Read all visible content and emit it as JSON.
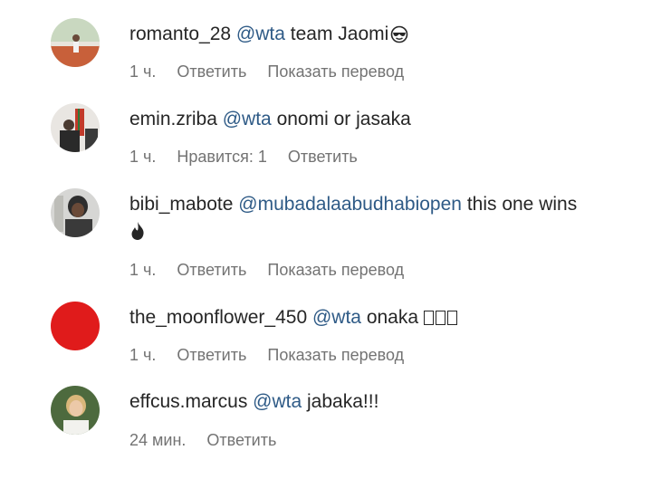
{
  "comments": [
    {
      "username": "romanto_28",
      "mention": "@wta",
      "text": "team Jaomi",
      "emoji": "smiling-face-with-sunglasses",
      "time": "1 ч.",
      "actions": [
        "Ответить",
        "Показать перевод"
      ]
    },
    {
      "username": "emin.zriba",
      "mention": "@wta",
      "text": "onomi or jasaka",
      "time": "1 ч.",
      "likes": "Нравится: 1",
      "actions": [
        "Ответить"
      ]
    },
    {
      "username": "bibi_mabote",
      "mention": "@mubadalaabudhabiopen",
      "text": "this one wins",
      "emoji": "fire",
      "time": "1 ч.",
      "actions": [
        "Ответить",
        "Показать перевод"
      ]
    },
    {
      "username": "the_moonflower_450",
      "mention": "@wta",
      "text": "onaka",
      "emoji": "unrendered-glyph-boxes",
      "time": "1 ч.",
      "actions": [
        "Ответить",
        "Показать перевод"
      ]
    },
    {
      "username": "effcus.marcus",
      "mention": "@wta",
      "text": "jabaka!!!",
      "time": "24 мин.",
      "actions": [
        "Ответить"
      ]
    }
  ],
  "colors": {
    "text": "#262626",
    "mention": "#2e5a86",
    "meta": "#737373",
    "avatar_red": "#e01b1b"
  }
}
